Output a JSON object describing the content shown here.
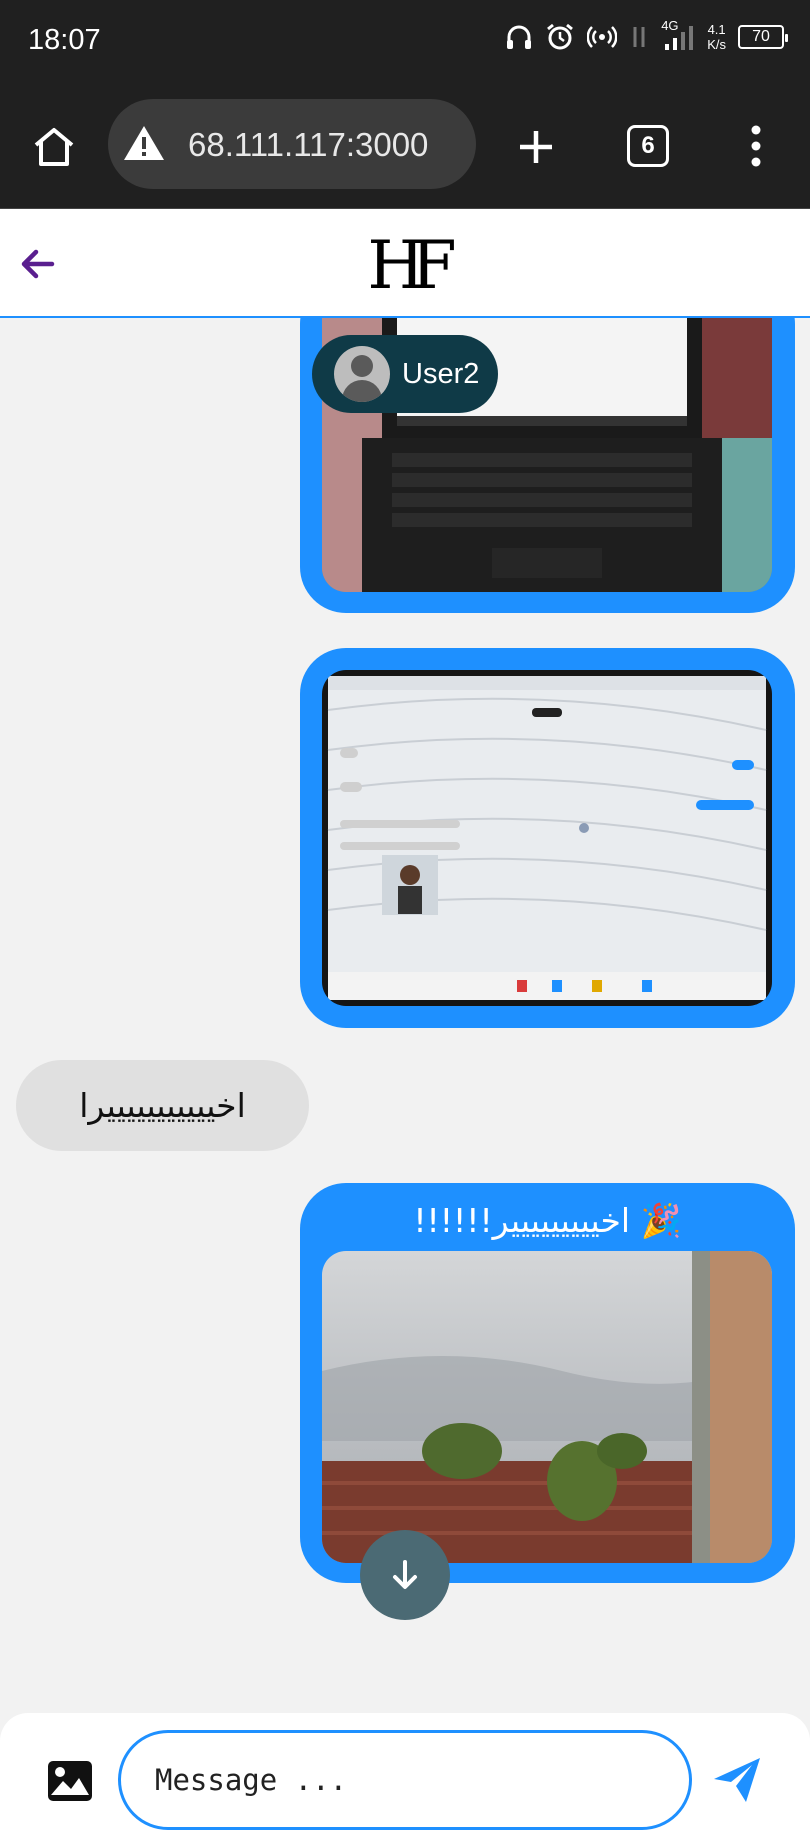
{
  "status_bar": {
    "time": "18:07",
    "network": "4G",
    "speed_value": "4.1",
    "speed_unit": "K/s",
    "battery": "70"
  },
  "browser": {
    "url": "68.111.117:3000",
    "tab_count": "6"
  },
  "app": {
    "logo": "HF"
  },
  "chat": {
    "user_chip": {
      "name": "User2"
    },
    "incoming_text": "اخيييييييييييرا",
    "outgoing_caption": "🎉 اخييييييييير!!!!!!"
  },
  "composer": {
    "placeholder": "Message ..."
  },
  "colors": {
    "accent": "#1e90ff",
    "back_arrow": "#5a1f8f",
    "chip": "#0f3a47"
  }
}
